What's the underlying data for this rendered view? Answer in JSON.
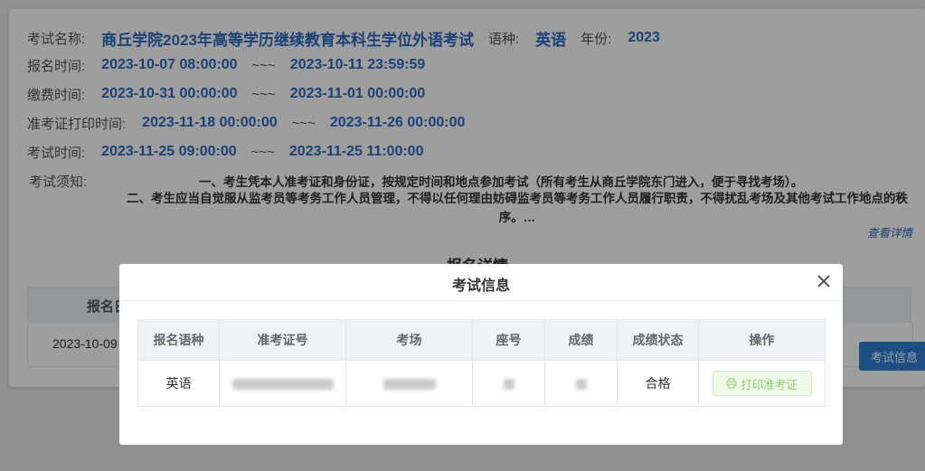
{
  "exam": {
    "name_label": "考试名称:",
    "name": "商丘学院2023年高等学历继续教育本科生学位外语考试",
    "lang_label": "语种:",
    "lang": "英语",
    "year_label": "年份:",
    "year": "2023"
  },
  "times": {
    "sep": "~~~",
    "signup": {
      "label": "报名时间:",
      "start": "2023-10-07 08:00:00",
      "end": "2023-10-11 23:59:59"
    },
    "payment": {
      "label": "缴费时间:",
      "start": "2023-10-31 00:00:00",
      "end": "2023-11-01 00:00:00"
    },
    "ticket": {
      "label": "准考证打印时间:",
      "start": "2023-11-18 00:00:00",
      "end": "2023-11-26 00:00:00"
    },
    "exam": {
      "label": "考试时间:",
      "start": "2023-11-25 09:00:00",
      "end": "2023-11-25 11:00:00"
    }
  },
  "notice": {
    "label": "考试须知:",
    "line1": "一、考生凭本人准考证和身份证，按规定时间和地点参加考试（所有考生从商丘学院东门进入，便于寻找考场）。",
    "line2": "二、考生应当自觉服从监考员等考务工作人员管理，不得以任何理由妨碍监考员等考务工作人员履行职责，不得扰乱考场及其他考试工作地点的秩序。…",
    "more": "查看详情"
  },
  "detail": {
    "title": "报名详情",
    "col_partial": "报名日",
    "row_date_partial": "2023-10-09",
    "btn": "考试信息"
  },
  "modal": {
    "title": "考试信息",
    "headers": [
      "报名语种",
      "准考证号",
      "考场",
      "座号",
      "成绩",
      "成绩状态",
      "操作"
    ],
    "row": {
      "lang": "英语",
      "status": "合格",
      "action": "打印准考证"
    }
  }
}
